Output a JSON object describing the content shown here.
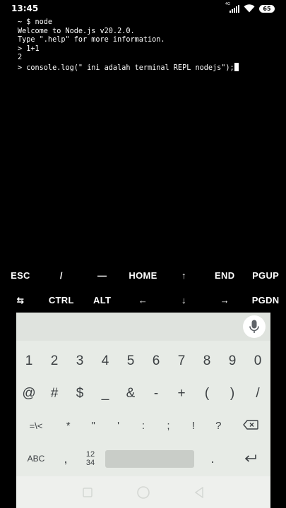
{
  "status_bar": {
    "time": "13:45",
    "network": "4G",
    "battery": "65"
  },
  "terminal": {
    "lines": [
      "~ $ node",
      "Welcome to Node.js v20.2.0.",
      "Type \".help\" for more information.",
      "> 1+1",
      "2",
      "> console.log(\" ini adalah terminal REPL nodejs\");"
    ]
  },
  "extra_keys": {
    "row1": [
      "ESC",
      "/",
      "—",
      "HOME",
      "↑",
      "END",
      "PGUP"
    ],
    "row2": [
      "⇆",
      "CTRL",
      "ALT",
      "←",
      "↓",
      "→",
      "PGDN"
    ]
  },
  "keyboard": {
    "digits": [
      "1",
      "2",
      "3",
      "4",
      "5",
      "6",
      "7",
      "8",
      "9",
      "0"
    ],
    "symbols1": [
      "@",
      "#",
      "$",
      "_",
      "&",
      "-",
      "+",
      "(",
      ")",
      "/"
    ],
    "symbols2": [
      "=\\<",
      "*",
      "\"",
      "'",
      ":",
      ";",
      "!",
      "?"
    ],
    "abc_label": "ABC",
    "comma": ",",
    "numpad_top": "12",
    "numpad_bottom": "34",
    "period": ".",
    "icons": [
      "mic-icon",
      "backspace-icon",
      "enter-icon"
    ]
  },
  "nav_bar": {
    "icons": [
      "recents-icon",
      "home-icon",
      "back-icon"
    ]
  }
}
